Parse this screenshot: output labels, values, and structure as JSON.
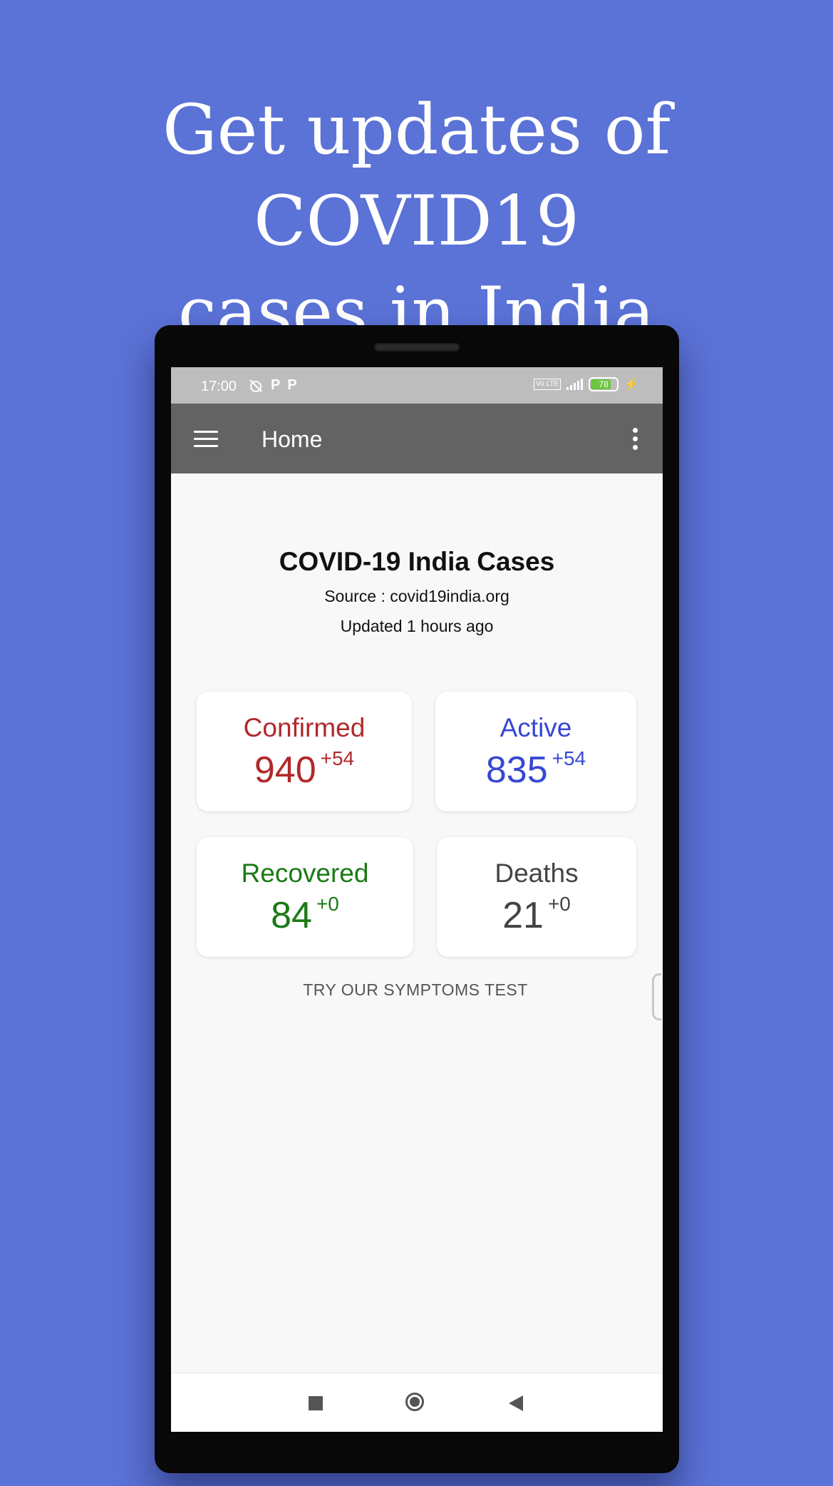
{
  "promo": {
    "line1": "Get updates of COVID19",
    "line2": "cases in India"
  },
  "status_bar": {
    "time": "17:00",
    "battery_level": "78",
    "volte_label": "Vo LTE",
    "colors": {
      "battery": "#6cc63f"
    }
  },
  "app_bar": {
    "title": "Home",
    "background": "#636363"
  },
  "main": {
    "title": "COVID-19 India Cases",
    "source": "Source : covid19india.org",
    "updated": "Updated  1 hours ago",
    "cards": [
      {
        "label": "Confirmed",
        "value": "940",
        "delta": "+54",
        "color": "#b0292b"
      },
      {
        "label": "Active",
        "value": "835",
        "delta": "+54",
        "color": "#3747d4"
      },
      {
        "label": "Recovered",
        "value": "84",
        "delta": "+0",
        "color": "#1a7a15"
      },
      {
        "label": "Deaths",
        "value": "21",
        "delta": "+0",
        "color": "#444444"
      }
    ],
    "symptoms_link": "TRY OUR SYMPTOMS TEST"
  },
  "icons": {
    "menu": "hamburger-menu-icon",
    "more": "more-vert-icon",
    "nav_recents": "square-icon",
    "nav_home": "circle-icon",
    "nav_back": "triangle-back-icon"
  },
  "colors": {
    "page_background": "#5b72d6",
    "screen_background": "#f8f8f8"
  }
}
